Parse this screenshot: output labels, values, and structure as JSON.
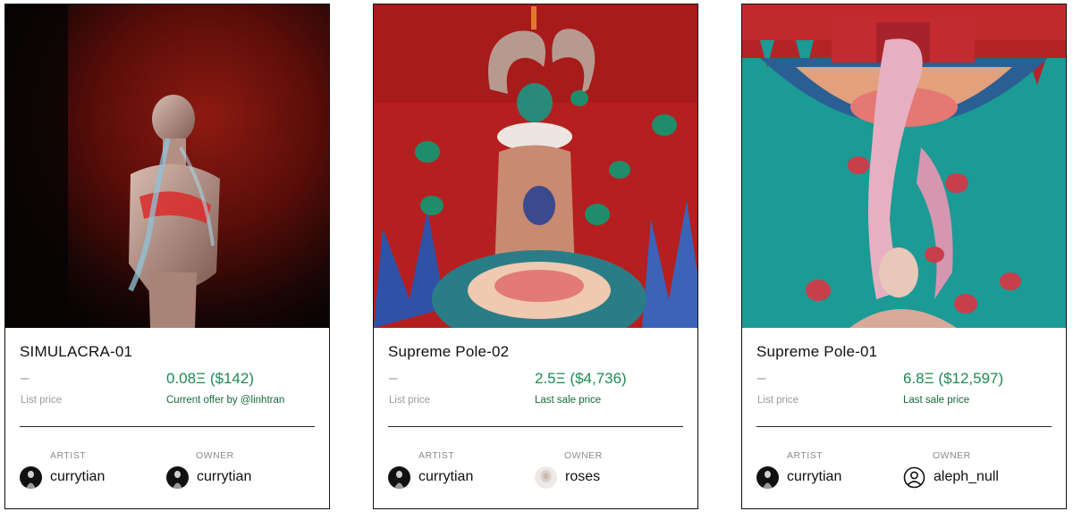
{
  "cards": [
    {
      "title": "SIMULACRA-01",
      "list_price": "–",
      "list_price_label": "List price",
      "price": "0.08Ξ ($142)",
      "price_label": "Current offer by @linhtran",
      "artist_label": "ARTIST",
      "artist": "currytian",
      "owner_label": "OWNER",
      "owner": "currytian"
    },
    {
      "title": "Supreme Pole-02",
      "list_price": "–",
      "list_price_label": "List price",
      "price": "2.5Ξ ($4,736)",
      "price_label": "Last sale price",
      "artist_label": "ARTIST",
      "artist": "currytian",
      "owner_label": "OWNER",
      "owner": "roses"
    },
    {
      "title": "Supreme Pole-01",
      "list_price": "–",
      "list_price_label": "List price",
      "price": "6.8Ξ ($12,597)",
      "price_label": "Last sale price",
      "artist_label": "ARTIST",
      "artist": "currytian",
      "owner_label": "OWNER",
      "owner": "aleph_null"
    }
  ],
  "colors": {
    "price_green": "#1f8a52",
    "muted_gray": "#9a9a9a",
    "border": "#111111"
  }
}
